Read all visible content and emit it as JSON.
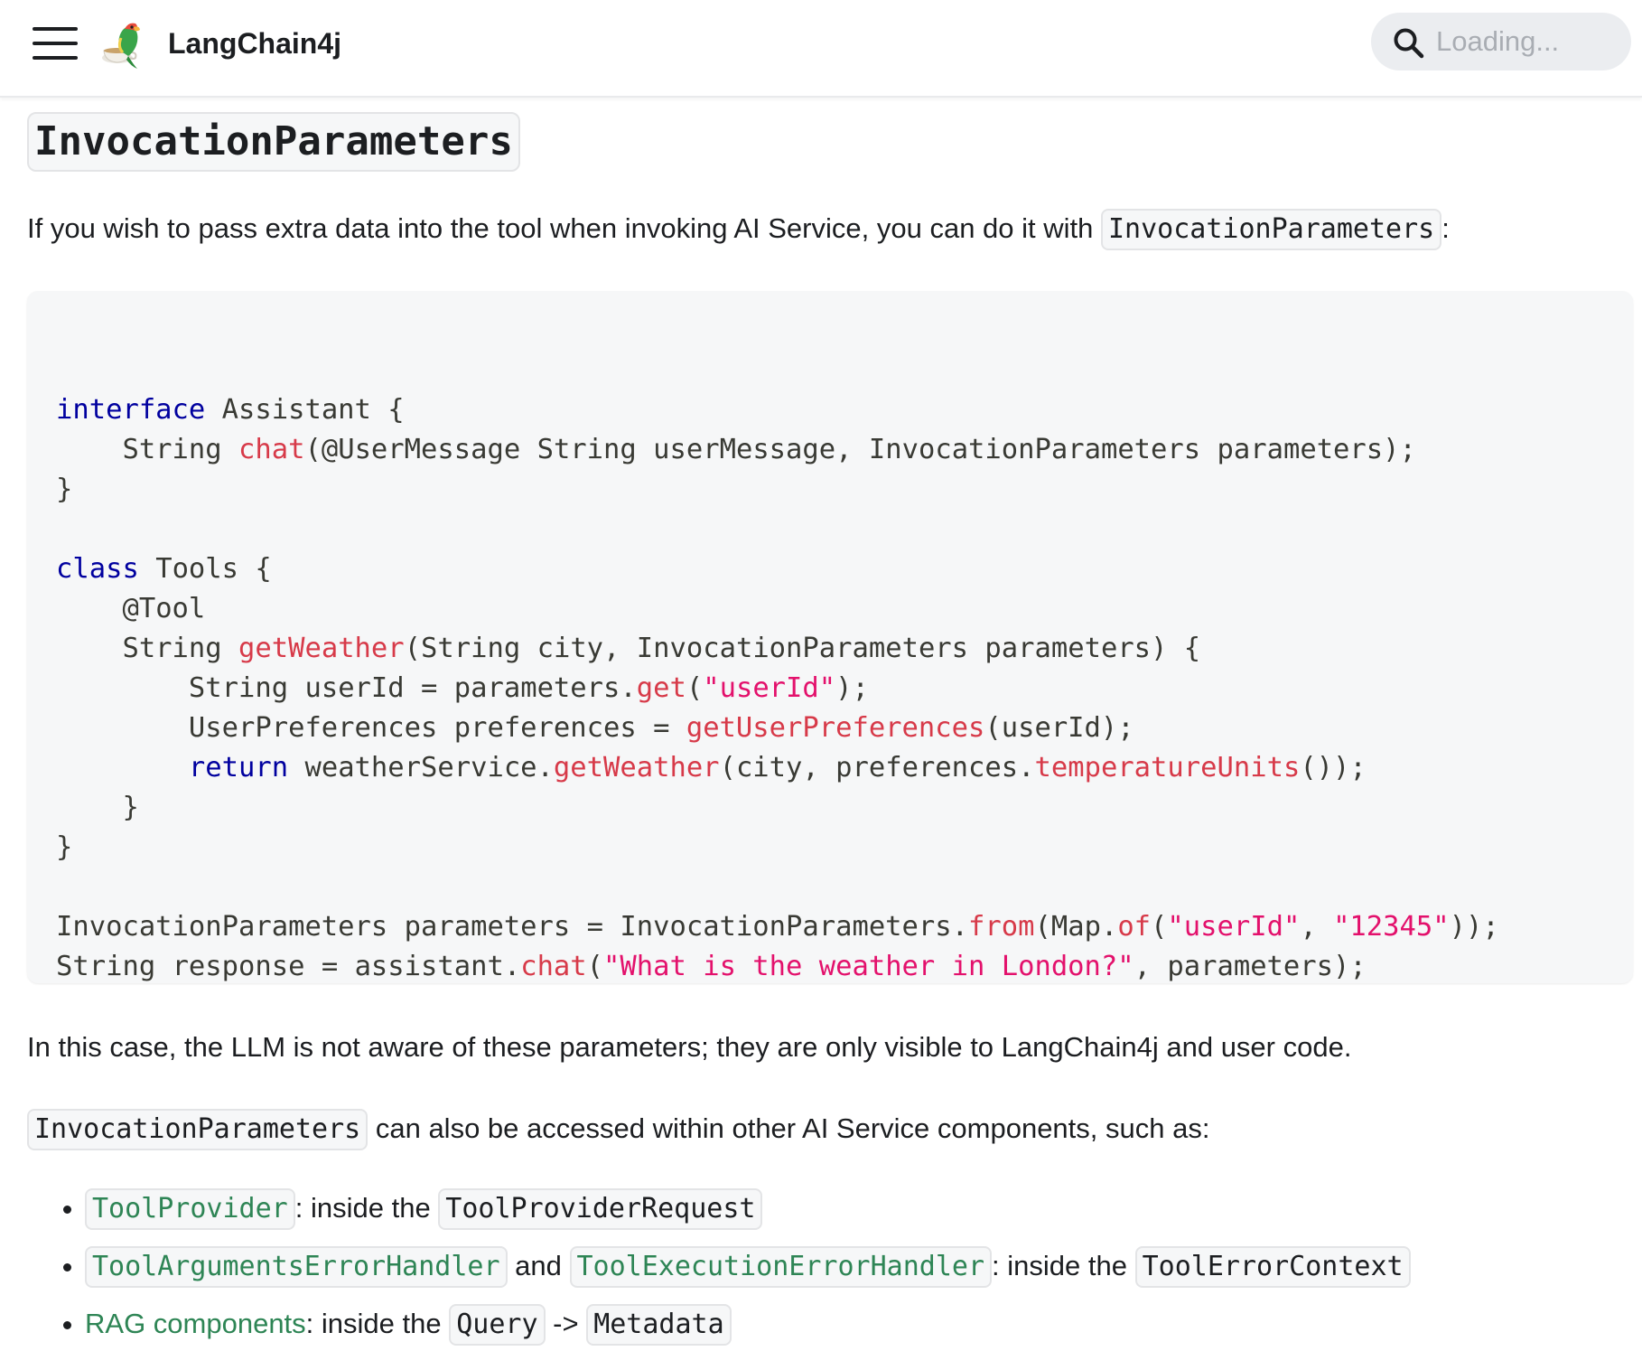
{
  "navbar": {
    "brand": "LangChain4j",
    "search_placeholder": "Loading...",
    "icons": [
      "menu-icon",
      "langchain4j-parrot-logo",
      "search-icon"
    ]
  },
  "section": {
    "heading": "InvocationParameters",
    "intro_text": "If you wish to pass extra data into the tool when invoking AI Service, you can do it with ",
    "intro_code": "InvocationParameters",
    "intro_suffix": ":"
  },
  "code_block": {
    "language": "java",
    "lines": [
      "",
      "interface Assistant {",
      "    String chat(@UserMessage String userMessage, InvocationParameters parameters);",
      "}",
      "",
      "class Tools {",
      "    @Tool",
      "    String getWeather(String city, InvocationParameters parameters) {",
      "        String userId = parameters.get(\"userId\");",
      "        UserPreferences preferences = getUserPreferences(userId);",
      "        return weatherService.getWeather(city, preferences.temperatureUnits());",
      "    }",
      "}",
      "",
      "InvocationParameters parameters = InvocationParameters.from(Map.of(\"userId\", \"12345\"));",
      "String response = assistant.chat(\"What is the weather in London?\", parameters);"
    ],
    "colors": {
      "keyword": "#00009f",
      "function": "#d73a49",
      "string": "#e3116c",
      "plain": "#393a34"
    }
  },
  "para2": "In this case, the LLM is not aware of these parameters; they are only visible to LangChain4j and user code.",
  "para3": {
    "code": "InvocationParameters",
    "text": " can also be accessed within other AI Service components, such as:"
  },
  "bullets": [
    {
      "link1": "ToolProvider",
      "text1": ": inside the ",
      "code1": "ToolProviderRequest"
    },
    {
      "link1": "ToolArgumentsErrorHandler",
      "text1": " and ",
      "link2": "ToolExecutionErrorHandler",
      "text2": ": inside the ",
      "code1": "ToolErrorContext"
    },
    {
      "link_text": "RAG components",
      "text1": ": inside the ",
      "code1": "Query",
      "text2": " -> ",
      "code2": "Metadata"
    }
  ],
  "theme": {
    "link_color": "#2e8555",
    "code_bg": "#f6f7f8",
    "text_color": "#1c1e21"
  }
}
